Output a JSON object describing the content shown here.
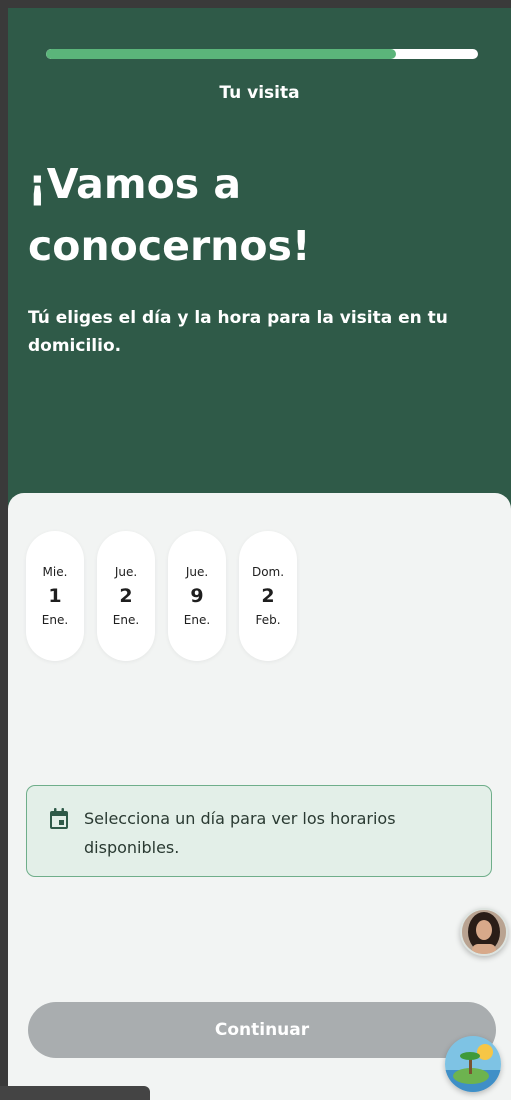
{
  "header": {
    "progress_percent": 81,
    "step_label": "Tu visita"
  },
  "hero": {
    "title_line1": "¡Vamos a",
    "title_line2": "conocernos!",
    "subtitle": "Tú eliges el día y la hora para la visita en tu domicilio."
  },
  "dates": [
    {
      "dow": "Mie.",
      "day": "1",
      "month": "Ene."
    },
    {
      "dow": "Jue.",
      "day": "2",
      "month": "Ene."
    },
    {
      "dow": "Jue.",
      "day": "9",
      "month": "Ene."
    },
    {
      "dow": "Dom.",
      "day": "2",
      "month": "Feb."
    }
  ],
  "info": {
    "icon": "calendar-icon",
    "text": "Selecciona un día para ver los horarios disponibles."
  },
  "actions": {
    "continue_label": "Continuar"
  },
  "colors": {
    "brand_green": "#2f5a48",
    "progress_fill": "#5bb57a",
    "info_border": "#6fae8a",
    "button_disabled": "#a9adaf"
  },
  "floating": {
    "avatar_icon": "assistant-avatar-icon",
    "badge_icon": "island-badge-icon"
  }
}
